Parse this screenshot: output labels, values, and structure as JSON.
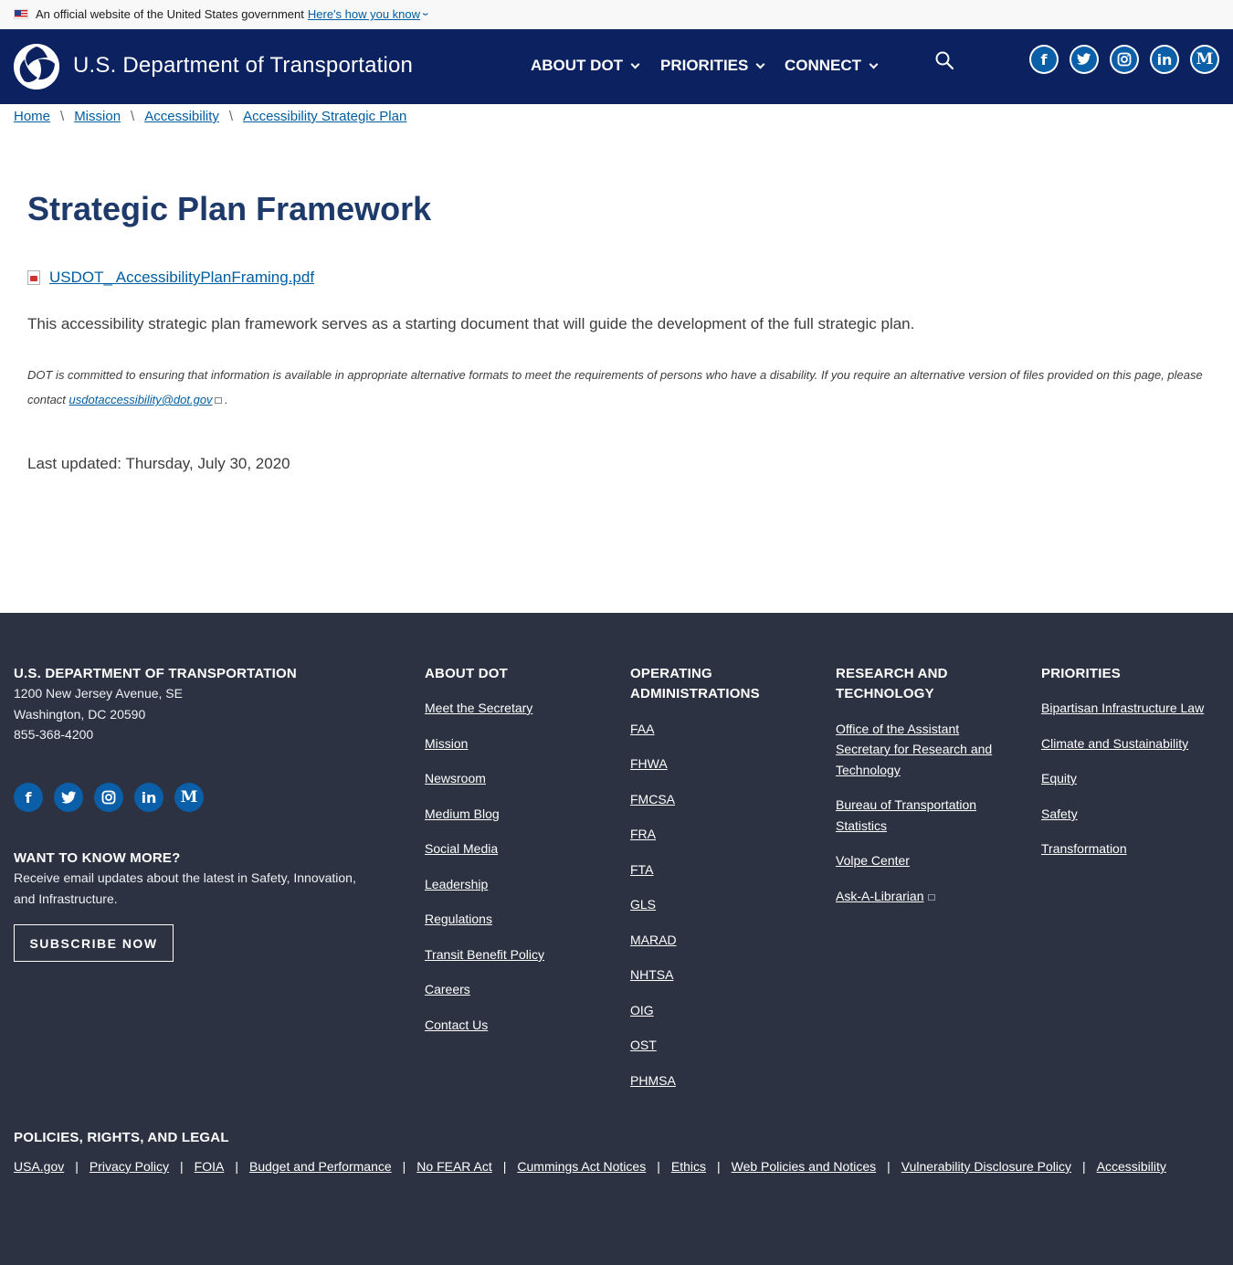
{
  "gov_banner": {
    "text": "An official website of the United States government",
    "link": "Here's how you know"
  },
  "header": {
    "title": "U.S. Department of Transportation",
    "nav": [
      {
        "label": "ABOUT DOT"
      },
      {
        "label": "PRIORITIES"
      },
      {
        "label": "CONNECT"
      }
    ],
    "social": [
      "facebook-icon",
      "twitter-icon",
      "instagram-icon",
      "linkedin-icon",
      "medium-icon"
    ],
    "brand_color": "#0b2160"
  },
  "breadcrumb": [
    "Home",
    "Mission",
    "Accessibility",
    "Accessibility Strategic Plan"
  ],
  "main": {
    "title": "Strategic Plan Framework",
    "pdf_link": "USDOT_ AccessibilityPlanFraming.pdf",
    "lead": "This accessibility strategic plan framework serves as a starting document that will guide the development of the full strategic plan.",
    "note_text": "DOT is committed to ensuring that information is available in appropriate alternative formats to meet the requirements of persons who have a disability. If you require an alternative version of files provided on this page, please contact",
    "note_email": "usdotaccessibility@dot.gov",
    "note_end": " .",
    "last_updated": "Last updated: Thursday, July 30, 2020"
  },
  "footer": {
    "org": {
      "heading": "U.S. DEPARTMENT OF TRANSPORTATION",
      "address1": "1200 New Jersey Avenue, SE",
      "address2": "Washington, DC 20590",
      "phone": "855-368-4200"
    },
    "more": {
      "heading": "WANT TO KNOW MORE?",
      "text1": "Receive email updates about the latest in Safety, Innovation,",
      "text2": "and Infrastructure.",
      "button": "SUBSCRIBE NOW"
    },
    "about": {
      "heading": "ABOUT DOT",
      "links": [
        "Meet the Secretary",
        "Mission",
        "Newsroom",
        "Medium Blog",
        "Social Media",
        "Leadership",
        "Regulations",
        "Transit Benefit Policy",
        "Careers",
        "Contact Us"
      ]
    },
    "operating": {
      "heading1": "OPERATING",
      "heading2": "ADMINISTRATIONS",
      "links": [
        "FAA",
        "FHWA",
        "FMCSA",
        "FRA",
        "FTA",
        "GLS",
        "MARAD",
        "NHTSA",
        "OIG",
        "OST",
        "PHMSA"
      ]
    },
    "research": {
      "heading1": "RESEARCH AND",
      "heading2": "TECHNOLOGY",
      "link1_l1": "Office of the Assistant",
      "link1_l2": "Secretary for Research and",
      "link1_l3": "Technology",
      "link2_l1": "Bureau of Transportation",
      "link2_l2": "Statistics",
      "link3": "Volpe Center",
      "link4": "Ask-A-Librarian"
    },
    "priorities": {
      "heading": "PRIORITIES",
      "links": [
        "Bipartisan Infrastructure Law",
        "Climate and Sustainability",
        "Equity",
        "Safety",
        "Transformation"
      ]
    },
    "legal": {
      "heading": "POLICIES, RIGHTS, AND LEGAL",
      "links": [
        "USA.gov",
        "Privacy Policy",
        "FOIA",
        "Budget and Performance",
        "No FEAR Act",
        "Cummings Act Notices",
        "Ethics",
        "Web Policies and Notices",
        "Vulnerability Disclosure Policy",
        "Accessibility"
      ]
    },
    "bg_color": "#2c3241"
  }
}
